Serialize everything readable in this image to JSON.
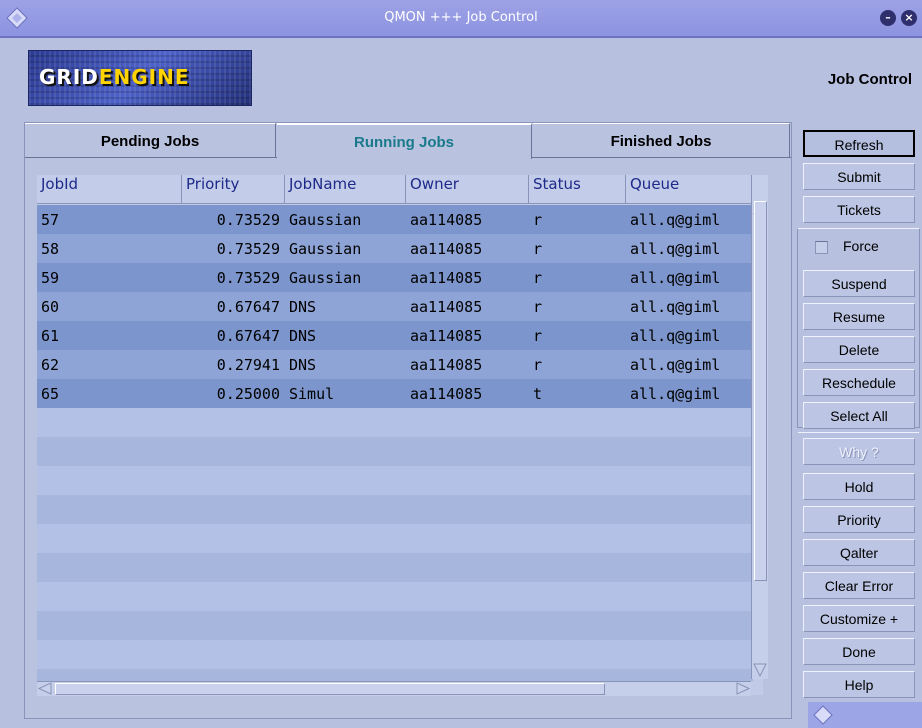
{
  "window": {
    "title": "QMON +++ Job Control",
    "minimize_icon": "minimize-icon",
    "close_icon": "close-icon"
  },
  "header": {
    "logo_part1": "GRID",
    "logo_part2": "ENGINE",
    "title": "Job Control"
  },
  "tabs": [
    {
      "label": "Pending Jobs",
      "active": false
    },
    {
      "label": "Running Jobs",
      "active": true
    },
    {
      "label": "Finished Jobs",
      "active": false
    }
  ],
  "table": {
    "columns": [
      "JobId",
      "Priority",
      "JobName",
      "Owner",
      "Status",
      "Queue"
    ],
    "rows": [
      {
        "jobid": "57",
        "priority": "0.73529",
        "jobname": "Gaussian",
        "owner": "aa114085",
        "status": "r",
        "queue": "all.q@giml"
      },
      {
        "jobid": "58",
        "priority": "0.73529",
        "jobname": "Gaussian",
        "owner": "aa114085",
        "status": "r",
        "queue": "all.q@giml"
      },
      {
        "jobid": "59",
        "priority": "0.73529",
        "jobname": "Gaussian",
        "owner": "aa114085",
        "status": "r",
        "queue": "all.q@giml"
      },
      {
        "jobid": "60",
        "priority": "0.67647",
        "jobname": "DNS",
        "owner": "aa114085",
        "status": "r",
        "queue": "all.q@giml"
      },
      {
        "jobid": "61",
        "priority": "0.67647",
        "jobname": "DNS",
        "owner": "aa114085",
        "status": "r",
        "queue": "all.q@giml"
      },
      {
        "jobid": "62",
        "priority": "0.27941",
        "jobname": "DNS",
        "owner": "aa114085",
        "status": "r",
        "queue": "all.q@giml"
      },
      {
        "jobid": "65",
        "priority": "0.25000",
        "jobname": "Simul",
        "owner": "aa114085",
        "status": "t",
        "queue": "all.q@giml"
      }
    ]
  },
  "buttons": {
    "refresh": "Refresh",
    "submit": "Submit",
    "tickets": "Tickets",
    "force": "Force",
    "suspend": "Suspend",
    "resume": "Resume",
    "delete": "Delete",
    "reschedule": "Reschedule",
    "select_all": "Select All",
    "why": "Why ?",
    "hold": "Hold",
    "priority": "Priority",
    "qalter": "Qalter",
    "clear_error": "Clear Error",
    "customize": "Customize +",
    "done": "Done",
    "help": "Help"
  },
  "colors": {
    "titlebar": "#9da2e6",
    "active_tab_text": "#1a7a8c",
    "column_header_text": "#1e2a8a",
    "selected_row": "#7c95cc"
  }
}
